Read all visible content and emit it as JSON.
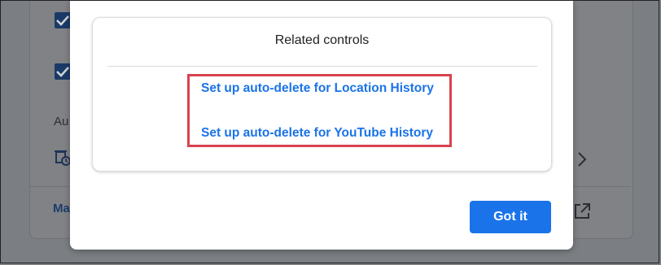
{
  "background": {
    "section_label": "Au",
    "manage_link": "Ma",
    "icons": [
      "checkbox-checked-icon",
      "auto-delete-icon",
      "chevron-right-icon",
      "open-in-new-icon"
    ]
  },
  "dialog": {
    "related_controls": {
      "title": "Related controls",
      "links": [
        "Set up auto-delete for Location History",
        "Set up auto-delete for YouTube History"
      ]
    },
    "got_it_label": "Got it"
  },
  "colors": {
    "link_blue": "#1a73e8",
    "highlight_red": "#d9424e",
    "button_blue": "#1a73e8",
    "overlay_gray": "#7b7e82"
  }
}
